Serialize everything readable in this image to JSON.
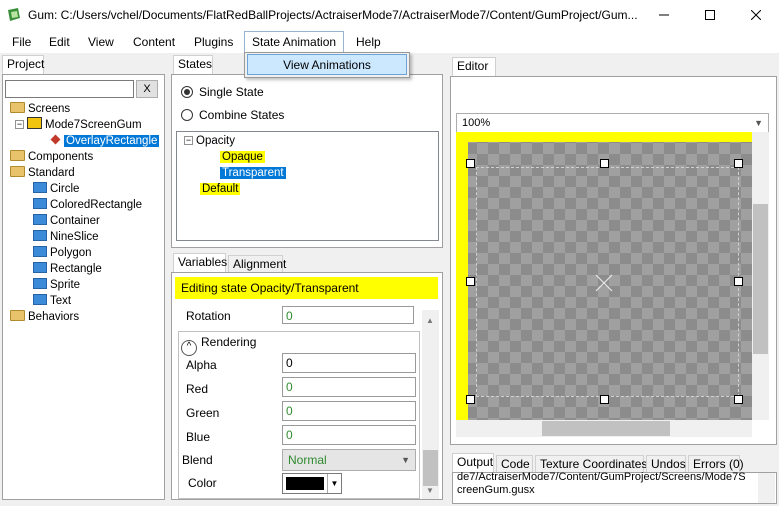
{
  "window": {
    "title": "Gum: C:/Users/vchel/Documents/FlatRedBallProjects/ActraiserMode7/ActraiserMode7/Content/GumProject/Gum...",
    "minimize_icon": "minimize-icon",
    "maximize_icon": "maximize-icon",
    "close_icon": "close-icon"
  },
  "menu": {
    "items": [
      "File",
      "Edit",
      "View",
      "Content",
      "Plugins",
      "State Animation",
      "Help"
    ],
    "open_menu": "State Animation",
    "dropdown_items": [
      "View Animations"
    ]
  },
  "project": {
    "tab": "Project",
    "search_placeholder": "",
    "clear_label": "X",
    "tree": {
      "screens": "Screens",
      "screen": "Mode7ScreenGum",
      "instance": "OverlayRectangle",
      "components": "Components",
      "standard": "Standard",
      "standard_items": [
        "Circle",
        "ColoredRectangle",
        "Container",
        "NineSlice",
        "Polygon",
        "Rectangle",
        "Sprite",
        "Text"
      ],
      "behaviors": "Behaviors"
    }
  },
  "states": {
    "tab": "States",
    "single_state": "Single State",
    "combine_states": "Combine States",
    "category": "Opacity",
    "items": [
      "Opaque",
      "Transparent"
    ],
    "default": "Default"
  },
  "variables": {
    "tabs": [
      "Variables",
      "Alignment"
    ],
    "banner": "Editing state Opacity/Transparent",
    "rotation_label": "Rotation",
    "rotation_value": "0",
    "section": "Rendering",
    "alpha_label": "Alpha",
    "alpha_value": "0",
    "red_label": "Red",
    "red_value": "0",
    "green_label": "Green",
    "green_value": "0",
    "blue_label": "Blue",
    "blue_value": "0",
    "blend_label": "Blend",
    "blend_value": "Normal",
    "color_label": "Color"
  },
  "editor": {
    "tab": "Editor",
    "zoom": "100%"
  },
  "output": {
    "tabs": [
      "Output",
      "Code",
      "Texture Coordinates",
      "Undos",
      "Errors (0)"
    ],
    "line1": "de7/ActraiserMode7/Content/GumProject/Screens/Mode7S",
    "line2": "creenGum.gusx"
  }
}
